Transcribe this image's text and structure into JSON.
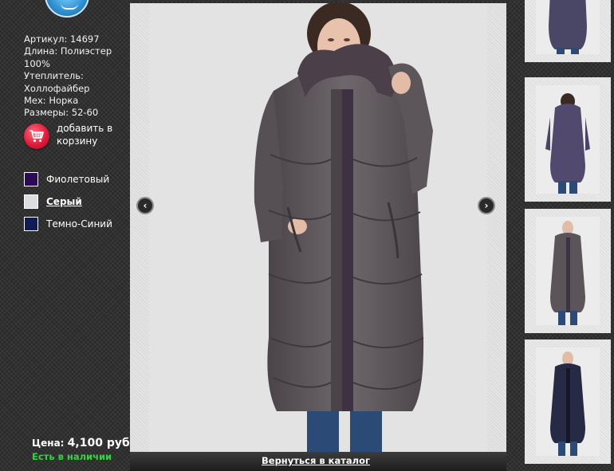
{
  "product": {
    "specs": [
      "Артикул: 14697",
      "Длина: Полиэстер",
      "100%",
      "Утеплитель:",
      "Холлофайбер",
      "Мех: Норка",
      "Размеры: 52-60"
    ],
    "cart_label": "добавить в корзину",
    "price_label": "Цена:",
    "price_value": "4,100 руб.",
    "stock": "Есть в наличии"
  },
  "colors": [
    {
      "label": "Фиолетовый",
      "hex": "#2d0a57",
      "selected": false
    },
    {
      "label": "Серый",
      "hex": "#dcdde3",
      "selected": true
    },
    {
      "label": "Темно-Синий",
      "hex": "#0f1d54",
      "selected": false
    }
  ],
  "gallery": {
    "prev_icon": "chevron-left-icon",
    "next_icon": "chevron-right-icon",
    "back_link": "Вернуться в каталог"
  },
  "thumbnails": [
    {
      "coat_color": "#4a4766",
      "view": "front-cropped"
    },
    {
      "coat_color": "#524a6e",
      "view": "back"
    },
    {
      "coat_color": "#5b555a",
      "view": "front"
    },
    {
      "coat_color": "#262a44",
      "view": "front"
    }
  ],
  "theme": {
    "accent_green": "#2fd63b",
    "cart_red": "#e21b3a",
    "main_coat": "#5f585d"
  }
}
